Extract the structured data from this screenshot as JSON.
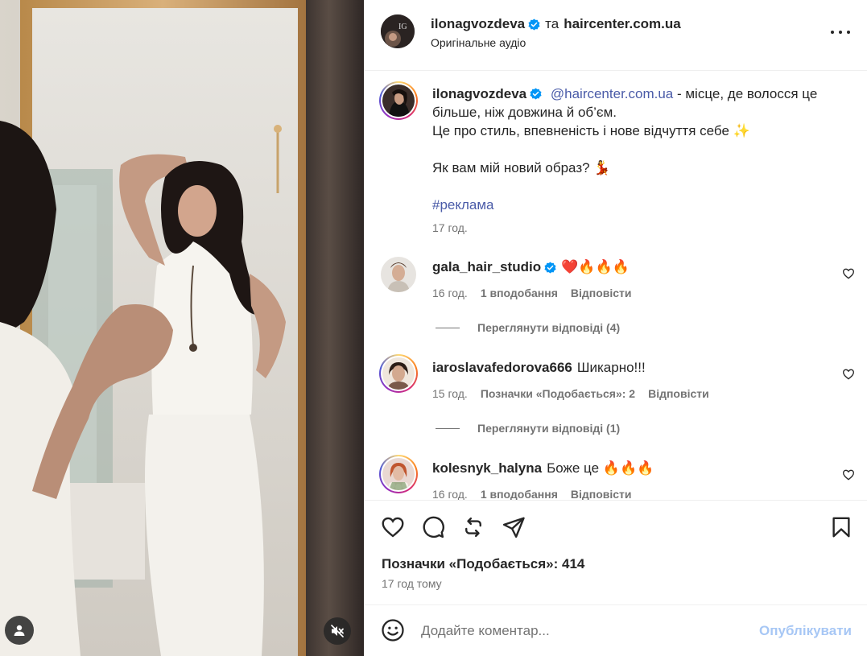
{
  "post_header": {
    "username": "ilonagvozdeva",
    "conjunction": "та",
    "collaborator": "haircenter.com.ua",
    "audio": "Оригінальне аудіо"
  },
  "caption": {
    "username": "ilonagvozdeva",
    "mention": "@haircenter.com.ua",
    "text_line1": " - місце, де волосся це більше, ніж довжина й об’єм.",
    "text_line2": "Це про стиль, впевненість і нове відчуття себе ✨",
    "text_line3": "Як вам мій новий образ? 💃",
    "hashtag": "#реклама",
    "time": "17 год."
  },
  "comments": [
    {
      "username": "gala_hair_studio",
      "verified": true,
      "text": "❤️🔥🔥🔥",
      "time": "16 год.",
      "likes": "1 вподобання",
      "reply": "Відповісти",
      "view_replies": "Переглянути відповіді (4)"
    },
    {
      "username": "iaroslavafedorova666",
      "verified": false,
      "text": "Шикарно!!!",
      "time": "15 год.",
      "likes": "Позначки «Подобається»: 2",
      "reply": "Відповісти",
      "view_replies": "Переглянути відповіді (1)"
    },
    {
      "username": "kolesnyk_halyna",
      "verified": false,
      "text": "Боже це 🔥🔥🔥",
      "time": "16 год.",
      "likes": "1 вподобання",
      "reply": "Відповісти"
    }
  ],
  "actions": {
    "likes": "Позначки «Подобається»: 414",
    "ago": "17 год тому"
  },
  "add_comment": {
    "placeholder": "Додайте коментар...",
    "publish": "Опублікувати"
  },
  "icons": {
    "verified": "verified-badge-icon",
    "more": "more-options-icon",
    "like": "heart-icon",
    "comment": "comment-icon",
    "repost": "repost-icon",
    "share": "share-icon",
    "save": "bookmark-icon",
    "emoji": "emoji-icon",
    "tag_user": "user-tag-icon",
    "mute": "muted-speaker-icon"
  },
  "colors": {
    "link": "#4a5ba8",
    "verified": "#0095f6",
    "publish_disabled": "#a7c7f5",
    "secondary_text": "#737373"
  }
}
